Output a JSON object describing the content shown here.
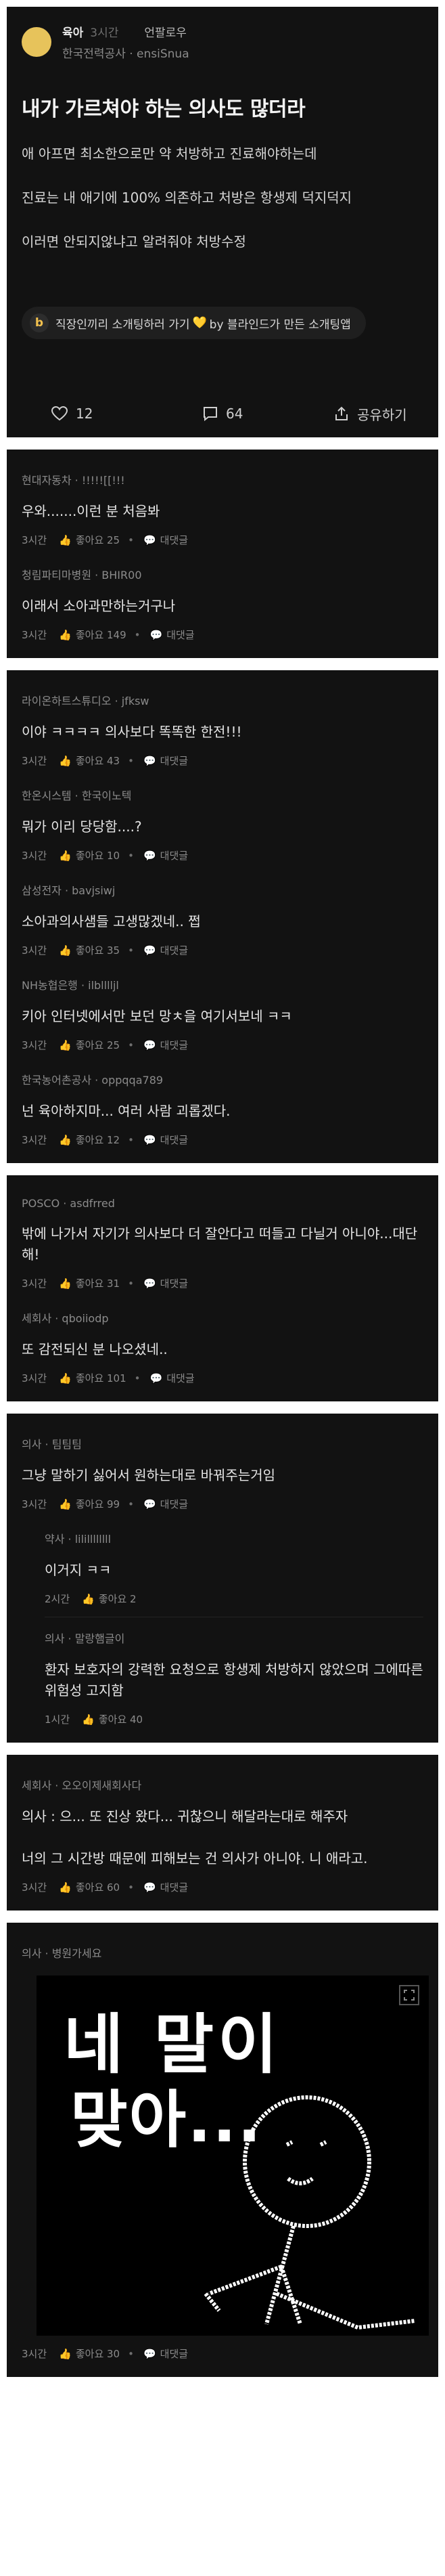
{
  "post": {
    "category": "육아",
    "time": "3시간",
    "topic": "언팔로우",
    "author": "한국전력공사 · ensiSnua",
    "title": "내가 가르쳐야 하는 의사도 많더라",
    "body": [
      "애 아프면 최소한으로만 약 처방하고 진료해야하는데",
      "진료는 내 애기에  100% 의존하고 처방은 항생제 덕지덕지",
      "이러면 안되지않냐고 알려줘야 처방수정"
    ],
    "promo": {
      "badge": "b",
      "text_before": "직장인끼리 소개팅하러 가기",
      "heart": "💛",
      "text_after": " by 블라인드가 만든 소개팅앱"
    },
    "likes": "12",
    "comments": "64",
    "share_label": "공유하기"
  },
  "comment_groups": [
    [
      {
        "meta": "현대자동차 · !!!!![[!!!",
        "text": "우와.......이런 분 처음봐",
        "time": "3시간",
        "like_label": "좋아요 25",
        "reply_label": "대댓글"
      },
      {
        "meta": "청림파티마병원 · BHIR00",
        "text": "이래서 소아과만하는거구나",
        "time": "3시간",
        "like_label": "좋아요 149",
        "reply_label": "대댓글"
      }
    ],
    [
      {
        "meta": "라이온하트스튜디오 · jfksw",
        "text": "이야 ㅋㅋㅋㅋ  의사보다 똑똑한 한전!!!",
        "time": "3시간",
        "like_label": "좋아요 43",
        "reply_label": "대댓글"
      },
      {
        "meta": "한온시스템 · 한국이노텍",
        "text": "뭐가 이리 당당함....?",
        "time": "3시간",
        "like_label": "좋아요 10",
        "reply_label": "대댓글"
      },
      {
        "meta": "삼성전자 · bavjsiwj",
        "text": "소아과의사샘들 고생많겠네.. 쩝",
        "time": "3시간",
        "like_label": "좋아요 35",
        "reply_label": "대댓글"
      },
      {
        "meta": "NH농협은행 · ilblllljl",
        "text": "키아 인터넷에서만 보던 망ㅊ을 여기서보네 ㅋㅋ",
        "time": "3시간",
        "like_label": "좋아요 25",
        "reply_label": "대댓글"
      },
      {
        "meta": "한국농어촌공사 · oppqqa789",
        "text": "넌 육아하지마... 여러 사람 괴롭겠다.",
        "time": "3시간",
        "like_label": "좋아요 12",
        "reply_label": "대댓글"
      }
    ],
    [
      {
        "meta": "POSCO · asdfrred",
        "text": "밖에 나가서 자기가 의사보다 더 잘안다고 떠들고 다닐거 아니야...대단해!",
        "time": "3시간",
        "like_label": "좋아요 31",
        "reply_label": "대댓글"
      },
      {
        "meta": "세회사 · qboiiodp",
        "text": "또 감전되신 분 나오셨네..",
        "time": "3시간",
        "like_label": "좋아요 101",
        "reply_label": "대댓글"
      }
    ],
    [
      {
        "meta": "의사 · 팀팀팀",
        "text": "그냥 말하기 싫어서 원하는대로 바꿔주는거임",
        "time": "3시간",
        "like_label": "좋아요 99",
        "reply_label": "대댓글"
      },
      {
        "meta": "약사 · lilillllllll",
        "text": "이거지 ㅋㅋ",
        "time": "2시간",
        "like_label": "좋아요 2",
        "reply_label": "",
        "reply": true
      },
      {
        "meta": "의사 · 말랑햄글이",
        "text": "환자 보호자의 강력한 요청으로 항생제 처방하지 않았으며 그에따른 위험성 고지함",
        "time": "1시간",
        "like_label": "좋아요 40",
        "reply_label": "",
        "reply": true
      }
    ],
    [
      {
        "meta": "세회사 · 오오이제새회사다",
        "text": "의사 : 으... 또 진상 왔다... 귀찮으니 해달라는대로 해주자\n\n너의 그 시간방 때문에 피해보는 건 의사가 아니야. 니 애라고.",
        "time": "3시간",
        "like_label": "좋아요 60",
        "reply_label": "대댓글"
      }
    ],
    [
      {
        "meta": "의사 · 병원가세요",
        "text": "",
        "time": "3시간",
        "like_label": "좋아요 30",
        "reply_label": "대댓글",
        "image": true,
        "image_text": [
          "네 말이",
          "맞아..."
        ]
      }
    ]
  ]
}
